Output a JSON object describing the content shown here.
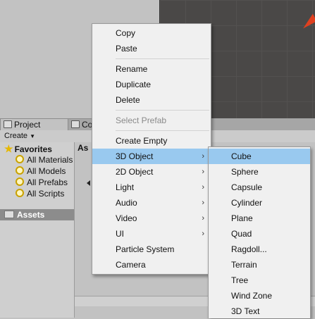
{
  "editor": {
    "tabs": [
      {
        "label": "Project",
        "active": true
      },
      {
        "label": "Co",
        "active": false
      }
    ],
    "create_label": "Create",
    "favorites": {
      "title": "Favorites",
      "items": [
        "All Materials",
        "All Models",
        "All Prefabs",
        "All Scripts"
      ]
    },
    "assets_label": "Assets",
    "breadcrumb": "As"
  },
  "context_menu": {
    "groups": [
      [
        "Copy",
        "Paste"
      ],
      [
        "Rename",
        "Duplicate",
        "Delete"
      ],
      [
        "Select Prefab"
      ],
      [
        "Create Empty",
        "3D Object",
        "2D Object",
        "Light",
        "Audio",
        "Video",
        "UI",
        "Particle System",
        "Camera"
      ]
    ],
    "items": {
      "copy": "Copy",
      "paste": "Paste",
      "rename": "Rename",
      "duplicate": "Duplicate",
      "delete": "Delete",
      "select_prefab": "Select Prefab",
      "create_empty": "Create Empty",
      "object_3d": "3D Object",
      "object_2d": "2D Object",
      "light": "Light",
      "audio": "Audio",
      "video": "Video",
      "ui": "UI",
      "particle_system": "Particle System",
      "camera": "Camera"
    },
    "highlighted": "3D Object",
    "disabled": [
      "Select Prefab"
    ],
    "has_submenu": [
      "3D Object",
      "2D Object",
      "Light",
      "Audio",
      "Video",
      "UI"
    ]
  },
  "submenu_3d": {
    "items": [
      "Cube",
      "Sphere",
      "Capsule",
      "Cylinder",
      "Plane",
      "Quad",
      "Ragdoll...",
      "Terrain",
      "Tree",
      "Wind Zone",
      "3D Text"
    ],
    "highlighted": "Cube"
  },
  "colors": {
    "menu_bg": "#f0f0f0",
    "highlight": "#99c9ef",
    "disabled_text": "#8a8a8a",
    "scene_bg": "#4a4847",
    "gizmo": "#e0401f"
  },
  "icons": {
    "submenu_arrow": "chevron-right-icon",
    "favorites": "star-icon",
    "saved_search": "search-icon",
    "folder": "folder-icon"
  }
}
